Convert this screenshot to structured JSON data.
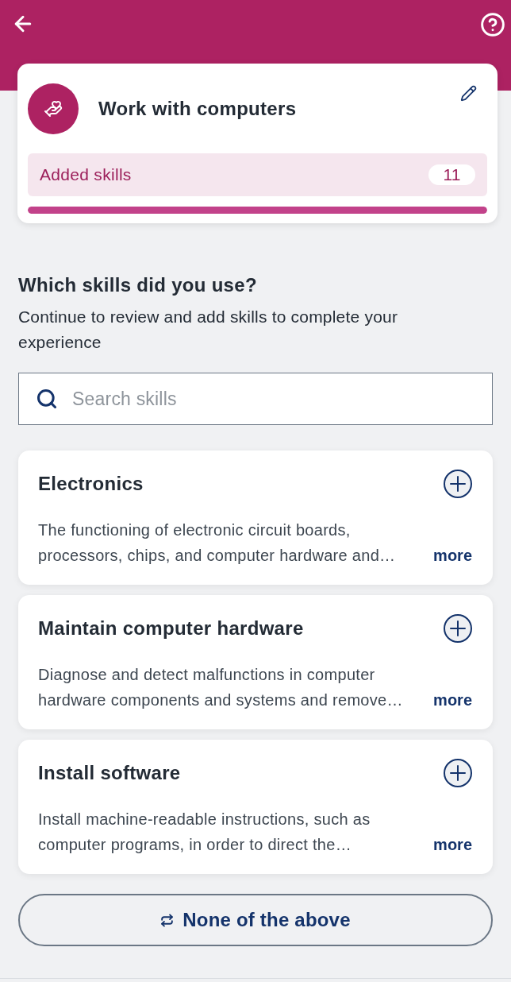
{
  "experience_card": {
    "title": "Work with computers",
    "added_skills": {
      "label": "Added skills",
      "count": "11"
    },
    "progress": {
      "level": 1
    }
  },
  "prompt": {
    "heading": "Which skills did you use?",
    "description": "Continue to review and add skills to complete your experience"
  },
  "search": {
    "placeholder": "Search skills"
  },
  "skills": [
    {
      "title": "Electronics",
      "description": "The functioning of electronic circuit boards, processors, chips, and computer hardware and…",
      "more": "more"
    },
    {
      "title": "Maintain computer hardware",
      "description": "Diagnose and detect malfunctions in computer hardware components and systems and remove…",
      "more": "more"
    },
    {
      "title": "Install software",
      "description": "Install machine-readable instructions, such as computer programs, in order to direct the…",
      "more": "more"
    }
  ],
  "none_button": {
    "label": "None of the above"
  }
}
